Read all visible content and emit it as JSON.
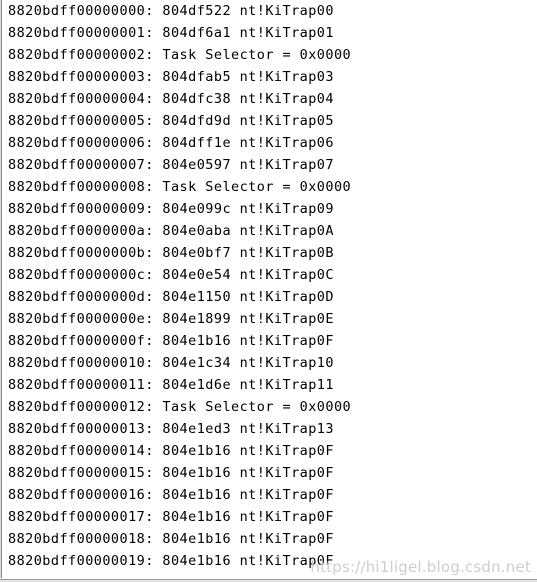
{
  "window": {
    "title": "IDT Dump",
    "accent_color": "#000000",
    "background_color": "#ffffff",
    "border_color": "#8a8a8a"
  },
  "watermark": {
    "text": "https://hi1ligel.blog.csdn.net"
  },
  "dump": {
    "address_base": "8820bdff",
    "separator": ": ",
    "lines": [
      {
        "address": "8820bdff00000000",
        "value": "804df522",
        "symbol": "nt!KiTrap00",
        "text": "8820bdff00000000: 804df522 nt!KiTrap00"
      },
      {
        "address": "8820bdff00000001",
        "value": "804df6a1",
        "symbol": "nt!KiTrap01",
        "text": "8820bdff00000001: 804df6a1 nt!KiTrap01"
      },
      {
        "address": "8820bdff00000002",
        "value": "Task Selector",
        "symbol": "= 0x0000",
        "text": "8820bdff00000002: Task Selector = 0x0000"
      },
      {
        "address": "8820bdff00000003",
        "value": "804dfab5",
        "symbol": "nt!KiTrap03",
        "text": "8820bdff00000003: 804dfab5 nt!KiTrap03"
      },
      {
        "address": "8820bdff00000004",
        "value": "804dfc38",
        "symbol": "nt!KiTrap04",
        "text": "8820bdff00000004: 804dfc38 nt!KiTrap04"
      },
      {
        "address": "8820bdff00000005",
        "value": "804dfd9d",
        "symbol": "nt!KiTrap05",
        "text": "8820bdff00000005: 804dfd9d nt!KiTrap05"
      },
      {
        "address": "8820bdff00000006",
        "value": "804dff1e",
        "symbol": "nt!KiTrap06",
        "text": "8820bdff00000006: 804dff1e nt!KiTrap06"
      },
      {
        "address": "8820bdff00000007",
        "value": "804e0597",
        "symbol": "nt!KiTrap07",
        "text": "8820bdff00000007: 804e0597 nt!KiTrap07"
      },
      {
        "address": "8820bdff00000008",
        "value": "Task Selector",
        "symbol": "= 0x0000",
        "text": "8820bdff00000008: Task Selector = 0x0000"
      },
      {
        "address": "8820bdff00000009",
        "value": "804e099c",
        "symbol": "nt!KiTrap09",
        "text": "8820bdff00000009: 804e099c nt!KiTrap09"
      },
      {
        "address": "8820bdff0000000a",
        "value": "804e0aba",
        "symbol": "nt!KiTrap0A",
        "text": "8820bdff0000000a: 804e0aba nt!KiTrap0A"
      },
      {
        "address": "8820bdff0000000b",
        "value": "804e0bf7",
        "symbol": "nt!KiTrap0B",
        "text": "8820bdff0000000b: 804e0bf7 nt!KiTrap0B"
      },
      {
        "address": "8820bdff0000000c",
        "value": "804e0e54",
        "symbol": "nt!KiTrap0C",
        "text": "8820bdff0000000c: 804e0e54 nt!KiTrap0C"
      },
      {
        "address": "8820bdff0000000d",
        "value": "804e1150",
        "symbol": "nt!KiTrap0D",
        "text": "8820bdff0000000d: 804e1150 nt!KiTrap0D"
      },
      {
        "address": "8820bdff0000000e",
        "value": "804e1899",
        "symbol": "nt!KiTrap0E",
        "text": "8820bdff0000000e: 804e1899 nt!KiTrap0E"
      },
      {
        "address": "8820bdff0000000f",
        "value": "804e1b16",
        "symbol": "nt!KiTrap0F",
        "text": "8820bdff0000000f: 804e1b16 nt!KiTrap0F"
      },
      {
        "address": "8820bdff00000010",
        "value": "804e1c34",
        "symbol": "nt!KiTrap10",
        "text": "8820bdff00000010: 804e1c34 nt!KiTrap10"
      },
      {
        "address": "8820bdff00000011",
        "value": "804e1d6e",
        "symbol": "nt!KiTrap11",
        "text": "8820bdff00000011: 804e1d6e nt!KiTrap11"
      },
      {
        "address": "8820bdff00000012",
        "value": "Task Selector",
        "symbol": "= 0x0000",
        "text": "8820bdff00000012: Task Selector = 0x0000"
      },
      {
        "address": "8820bdff00000013",
        "value": "804e1ed3",
        "symbol": "nt!KiTrap13",
        "text": "8820bdff00000013: 804e1ed3 nt!KiTrap13"
      },
      {
        "address": "8820bdff00000014",
        "value": "804e1b16",
        "symbol": "nt!KiTrap0F",
        "text": "8820bdff00000014: 804e1b16 nt!KiTrap0F"
      },
      {
        "address": "8820bdff00000015",
        "value": "804e1b16",
        "symbol": "nt!KiTrap0F",
        "text": "8820bdff00000015: 804e1b16 nt!KiTrap0F"
      },
      {
        "address": "8820bdff00000016",
        "value": "804e1b16",
        "symbol": "nt!KiTrap0F",
        "text": "8820bdff00000016: 804e1b16 nt!KiTrap0F"
      },
      {
        "address": "8820bdff00000017",
        "value": "804e1b16",
        "symbol": "nt!KiTrap0F",
        "text": "8820bdff00000017: 804e1b16 nt!KiTrap0F"
      },
      {
        "address": "8820bdff00000018",
        "value": "804e1b16",
        "symbol": "nt!KiTrap0F",
        "text": "8820bdff00000018: 804e1b16 nt!KiTrap0F"
      },
      {
        "address": "8820bdff00000019",
        "value": "804e1b16",
        "symbol": "nt!KiTrap0F",
        "text": "8820bdff00000019: 804e1b16 nt!KiTrap0F"
      }
    ]
  }
}
